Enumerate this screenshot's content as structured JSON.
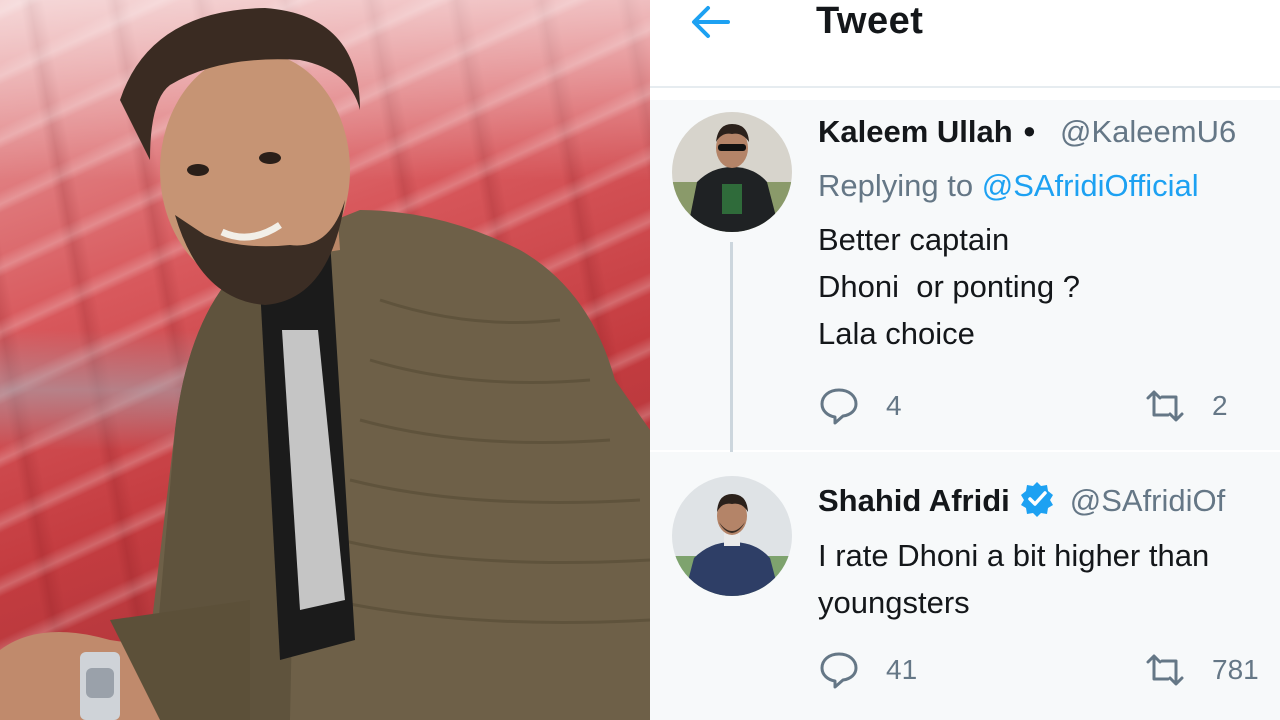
{
  "header": {
    "title": "Tweet"
  },
  "tweets": [
    {
      "display_name": "Kaleem Ullah",
      "separator": "●",
      "handle": "@KaleemU6",
      "replying_label": "Replying to",
      "replying_to": "@SAfridiOfficial",
      "text_lines": [
        "Better captain",
        "Dhoni  or ponting ?",
        "Lala choice"
      ],
      "reply_count": "4",
      "retweet_count": "2",
      "verified": false
    },
    {
      "display_name": "Shahid Afridi",
      "handle": "@SAfridiOf",
      "text_lines": [
        "I rate Dhoni a bit higher than",
        "youngsters"
      ],
      "reply_count": "41",
      "retweet_count": "781",
      "verified": true
    }
  ],
  "colors": {
    "accent": "#1da1f2",
    "text": "#14171a",
    "secondary": "#657786",
    "tweet_bg": "#f7f9fa"
  },
  "icons": {
    "back": "arrow-left-icon",
    "reply": "speech-bubble-icon",
    "retweet": "retweet-arrows-icon",
    "verified": "verified-badge-icon"
  }
}
